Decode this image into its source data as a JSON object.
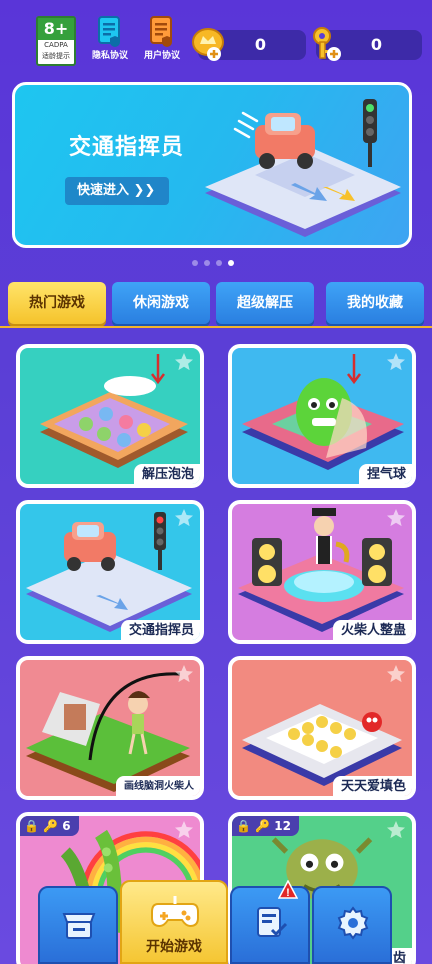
{
  "top_bar": {
    "age_rating": {
      "number": "8+",
      "org": "CADPA",
      "tip": "适龄提示"
    },
    "privacy_label": "隐私协议",
    "user_agreement_label": "用户协议",
    "coins": "0",
    "keys": "0"
  },
  "banner": {
    "title": "交通指挥员",
    "button_label": "快速进入 ❯❯",
    "pager": {
      "count": 4,
      "active_index": 3
    }
  },
  "tabs": [
    {
      "label": "热门游戏",
      "active": true
    },
    {
      "label": "休闲游戏",
      "active": false
    },
    {
      "label": "超级解压",
      "active": false
    },
    {
      "label": "我的收藏",
      "active": false
    }
  ],
  "games": [
    {
      "label": "解压泡泡"
    },
    {
      "label": "捏气球"
    },
    {
      "label": "交通指挥员"
    },
    {
      "label": "火柴人整蛊"
    },
    {
      "label": "画线脑洞火柴人"
    },
    {
      "label": "天天爱填色"
    },
    {
      "label": "",
      "lock_keys": "6"
    },
    {
      "label": "齿",
      "lock_keys": "12"
    }
  ],
  "bottom_nav": {
    "start_game_label": "开始游戏",
    "task_notification": "!"
  },
  "colors": {
    "background": "#5a35d8",
    "tab_active": "#f5c32b",
    "tab_inactive": "#2a7fe0",
    "accent_yellow": "#ffe46a"
  }
}
